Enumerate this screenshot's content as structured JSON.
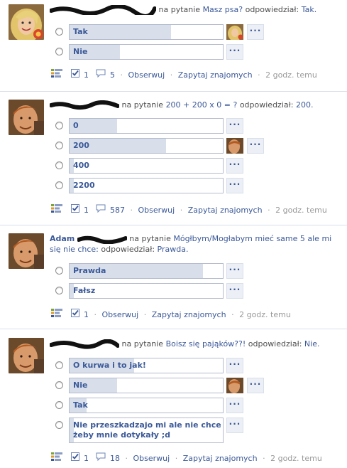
{
  "stories": [
    {
      "header_prefix": "na pytanie",
      "question": "Masz psa?",
      "answered_label": "odpowiedział:",
      "answer": "Tak.",
      "options": [
        {
          "label": "Tak",
          "fill": 0.66,
          "has_voter": true
        },
        {
          "label": "Nie",
          "fill": 0.33,
          "has_voter": false
        }
      ],
      "footer": {
        "votes": "1",
        "comments": "5",
        "follow": "Obserwuj",
        "ask": "Zapytaj znajomych",
        "time": "2 godz. temu"
      }
    },
    {
      "header_prefix": "na pytanie",
      "question": "200 + 200 x 0 = ?",
      "answered_label": "odpowiedział:",
      "answer": "200.",
      "options": [
        {
          "label": "0",
          "fill": 0.31,
          "has_voter": false
        },
        {
          "label": "200",
          "fill": 0.63,
          "has_voter": true
        },
        {
          "label": "400",
          "fill": 0.03,
          "has_voter": false
        },
        {
          "label": "2200",
          "fill": 0.03,
          "has_voter": false
        }
      ],
      "footer": {
        "votes": "1",
        "comments": "587",
        "follow": "Obserwuj",
        "ask": "Zapytaj znajomych",
        "time": "2 godz. temu"
      }
    },
    {
      "header_name": "Adam",
      "header_prefix": "na pytanie",
      "question": "Mógłbym/Mogłabym mieć same 5 ale mi się nie chce:",
      "answered_label": "odpowiedział:",
      "answer": "Prawda.",
      "options": [
        {
          "label": "Prawda",
          "fill": 0.87,
          "has_voter": false
        },
        {
          "label": "Fałsz",
          "fill": 0.03,
          "has_voter": false
        }
      ],
      "footer": {
        "votes": "1",
        "follow": "Obserwuj",
        "ask": "Zapytaj znajomych",
        "time": "2 godz. temu"
      }
    },
    {
      "header_prefix": "na pytanie",
      "question": "Boisz się pająków??!",
      "answered_label": "odpowiedział:",
      "answer": "Nie.",
      "options": [
        {
          "label": "O kurwa i to jak!",
          "fill": 0.42,
          "has_voter": false
        },
        {
          "label": "Nie",
          "fill": 0.31,
          "has_voter": true
        },
        {
          "label": "Tak",
          "fill": 0.11,
          "has_voter": false
        },
        {
          "label": "Nie przeszkadzajo mi ale nie chce żeby mnie dotykały ;d",
          "fill": 0.03,
          "has_voter": false
        }
      ],
      "footer": {
        "votes": "1",
        "comments": "18",
        "follow": "Obserwuj",
        "ask": "Zapytaj znajomych",
        "time": "2 godz. temu"
      }
    }
  ],
  "colors": {
    "link": "#3b5998",
    "bar_fill": "#d8dfea",
    "bar_border": "#b4bbcd",
    "muted": "#999999"
  },
  "icons": {
    "poll": "poll-icon",
    "check": "checkmark-icon",
    "comment": "comment-icon",
    "more": "ellipsis-icon"
  }
}
